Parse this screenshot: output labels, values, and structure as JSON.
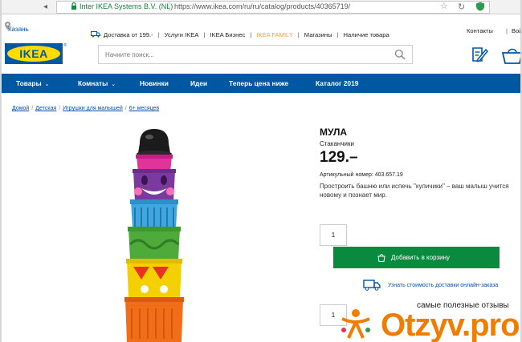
{
  "browser": {
    "org_badge": "Inter IKEA Systems B.V. (NL)",
    "url": "https://www.ikea.com/ru/ru/catalog/products/40365719/"
  },
  "header": {
    "location": "Казань",
    "top_links": [
      "Доставка от 199.-",
      "Услуги IKEA",
      "IKEA Бизнес",
      "IKEA FAMILY",
      "Магазины",
      "Наличие товара"
    ],
    "contacts": "Контакты",
    "login": "Вой",
    "logo_text": "IKEA",
    "logo_reg": "®",
    "search_placeholder": "Начните поиск...",
    "colors": {
      "brand_blue": "#0058a3",
      "brand_yellow": "#ffdb00",
      "family_orange": "#f3a33a"
    }
  },
  "nav": {
    "items": [
      "Товары",
      "Комнаты",
      "Новинки",
      "Идеи",
      "Теперь цена ниже",
      "Каталог 2019"
    ]
  },
  "breadcrumb": [
    "Домой",
    "Детская",
    "Игрушки для малышей",
    "6+ месяцев"
  ],
  "product": {
    "name": "МУЛА",
    "subtitle": "Стаканчики",
    "price": "129.–",
    "article": "Артикульный номер: 403.657.19",
    "description": "Простроить башню или испечь \"куличики\" – ваш малыш учится новому и познает мир.",
    "quantity": "1",
    "quantity_second": "1",
    "add_to_cart": "Добавить в корзину",
    "delivery_link": "Узнать стоимость доставки онлайн-заказа",
    "colors": {
      "cart_green": "#0a8a3e"
    }
  },
  "watermark": {
    "tagline": "самые полезные отзывы",
    "brand": "Otzyv.pro",
    "color": "#f07d00"
  }
}
